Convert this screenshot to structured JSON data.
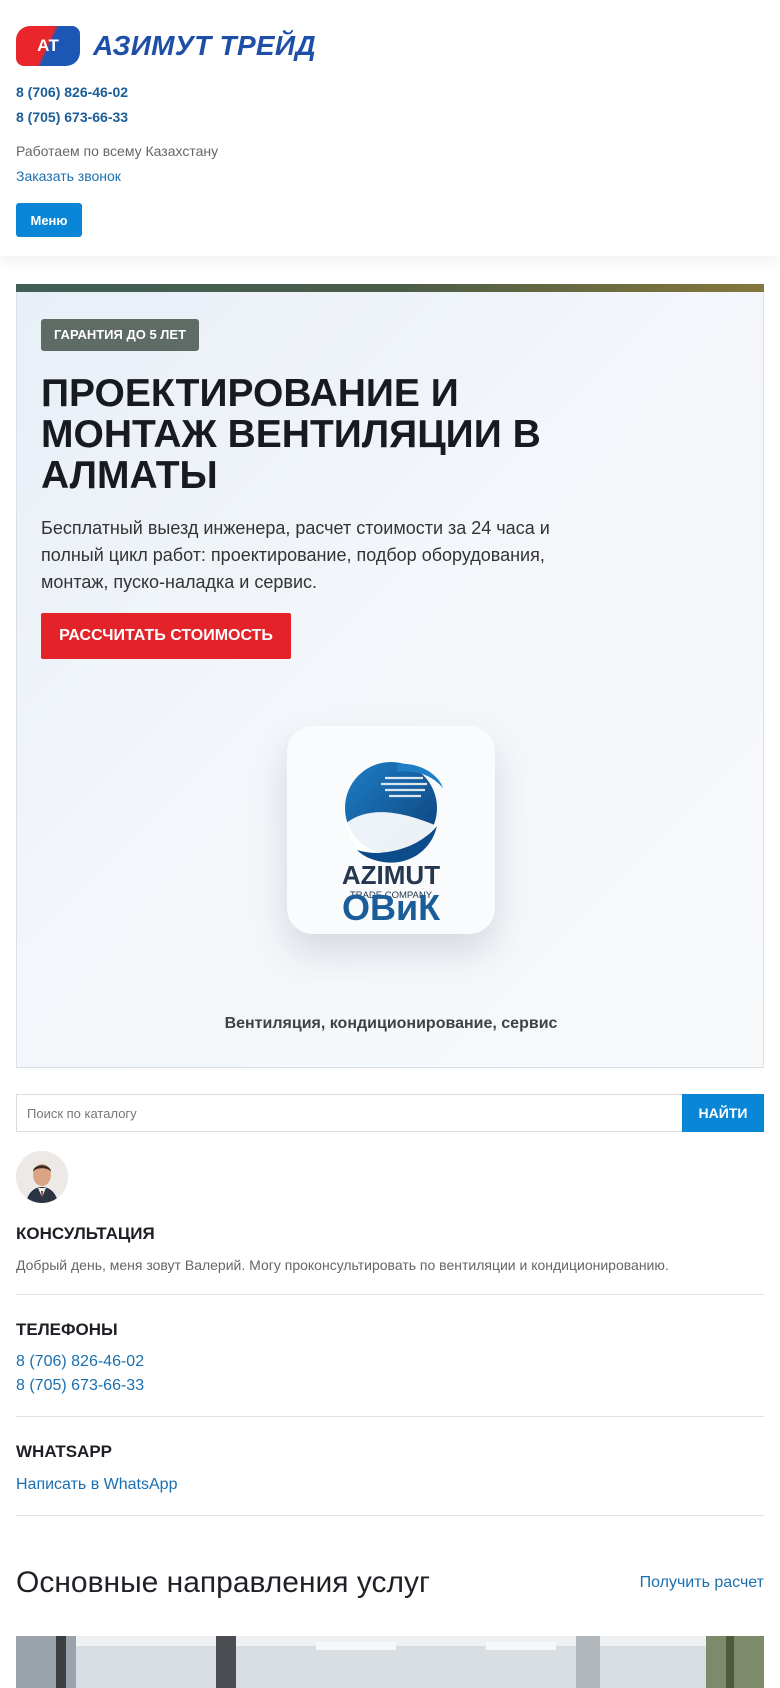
{
  "header": {
    "logo_badge": "АТ",
    "logo_text": "АЗИМУТ ТРЕЙД",
    "phones": [
      "8 (706) 826-46-02",
      "8 (705) 673-66-33"
    ],
    "work_area": "Работаем по всему Казахстану",
    "callback_link": "Заказать звонок",
    "menu_button": "Меню"
  },
  "hero": {
    "badge": "ГАРАНТИЯ ДО 5 ЛЕТ",
    "title": "ПРОЕКТИРОВАНИЕ И МОНТАЖ ВЕНТИЛЯЦИИ В АЛМАТЫ",
    "description": "Бесплатный выезд инженера, расчет стоимости за 24 часа и полный цикл работ: проектирование, подбор оборудования, монтаж, пуско-наладка и сервис.",
    "cta_button": "РАССЧИТАТЬ СТОИМОСТЬ",
    "card_logo_name": "AZIMUT",
    "card_logo_sub": "TRADE COMPANY",
    "brand_name": "ОВиК",
    "brand_subtitle": "Вентиляция, кондиционирование, сервис"
  },
  "search": {
    "placeholder": "Поиск по каталогу",
    "button": "НАЙТИ"
  },
  "consultation": {
    "title": "КОНСУЛЬТАЦИЯ",
    "text": "Добрый день, меня зовут Валерий. Могу проконсультировать по вентиляции и кондиционированию."
  },
  "phones_block": {
    "title": "ТЕЛЕФОНЫ",
    "phones": [
      "8 (706) 826-46-02",
      "8 (705) 673-66-33"
    ]
  },
  "whatsapp": {
    "title": "WHATSAPP",
    "link": "Написать в WhatsApp"
  },
  "services": {
    "title": "Основные направления услуг",
    "link": "Получить расчет"
  },
  "colors": {
    "accent_blue": "#0a86d6",
    "link_blue": "#1a6fb0",
    "cta_red": "#e4222a",
    "brand_blue": "#1a5d99"
  }
}
